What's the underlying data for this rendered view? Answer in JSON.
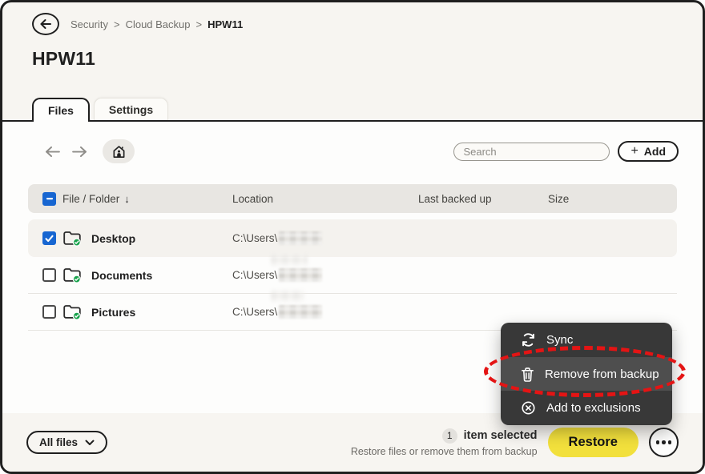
{
  "breadcrumb": {
    "items": [
      "Security",
      "Cloud Backup",
      "HPW11"
    ],
    "separator": ">"
  },
  "page": {
    "title": "HPW11"
  },
  "tabs": [
    {
      "label": "Files",
      "active": true
    },
    {
      "label": "Settings",
      "active": false
    }
  ],
  "toolbar": {
    "search_placeholder": "Search",
    "add_plus": "+",
    "add_label": "Add"
  },
  "table": {
    "headers": {
      "name": "File / Folder",
      "sort_icon": "↓",
      "location": "Location",
      "last_backed_up": "Last backed up",
      "size": "Size"
    },
    "rows": [
      {
        "name": "Desktop",
        "location_prefix": "C:\\Users\\",
        "checked": true,
        "location_censored": true
      },
      {
        "name": "Documents",
        "location_prefix": "C:\\Users\\",
        "checked": false,
        "location_censored": true
      },
      {
        "name": "Pictures",
        "location_prefix": "C:\\Users\\",
        "checked": false,
        "location_censored": true
      }
    ]
  },
  "context_menu": {
    "items": [
      {
        "label": "Sync",
        "icon": "sync-icon",
        "highlighted": false
      },
      {
        "label": "Remove from backup",
        "icon": "trash-icon",
        "highlighted": true
      },
      {
        "label": "Add to exclusions",
        "icon": "exclude-circle-icon",
        "highlighted": false
      }
    ]
  },
  "footer": {
    "filter_label": "All files",
    "selected_count": "1",
    "selected_text": "item selected",
    "hint_text": "Restore files or remove them from backup",
    "restore_label": "Restore"
  },
  "colors": {
    "accent_blue": "#1766d1",
    "badge_green": "#17a24b",
    "restore_yellow": "#f2e03c",
    "annotation_red": "#e41414",
    "menu_background": "#383838"
  }
}
